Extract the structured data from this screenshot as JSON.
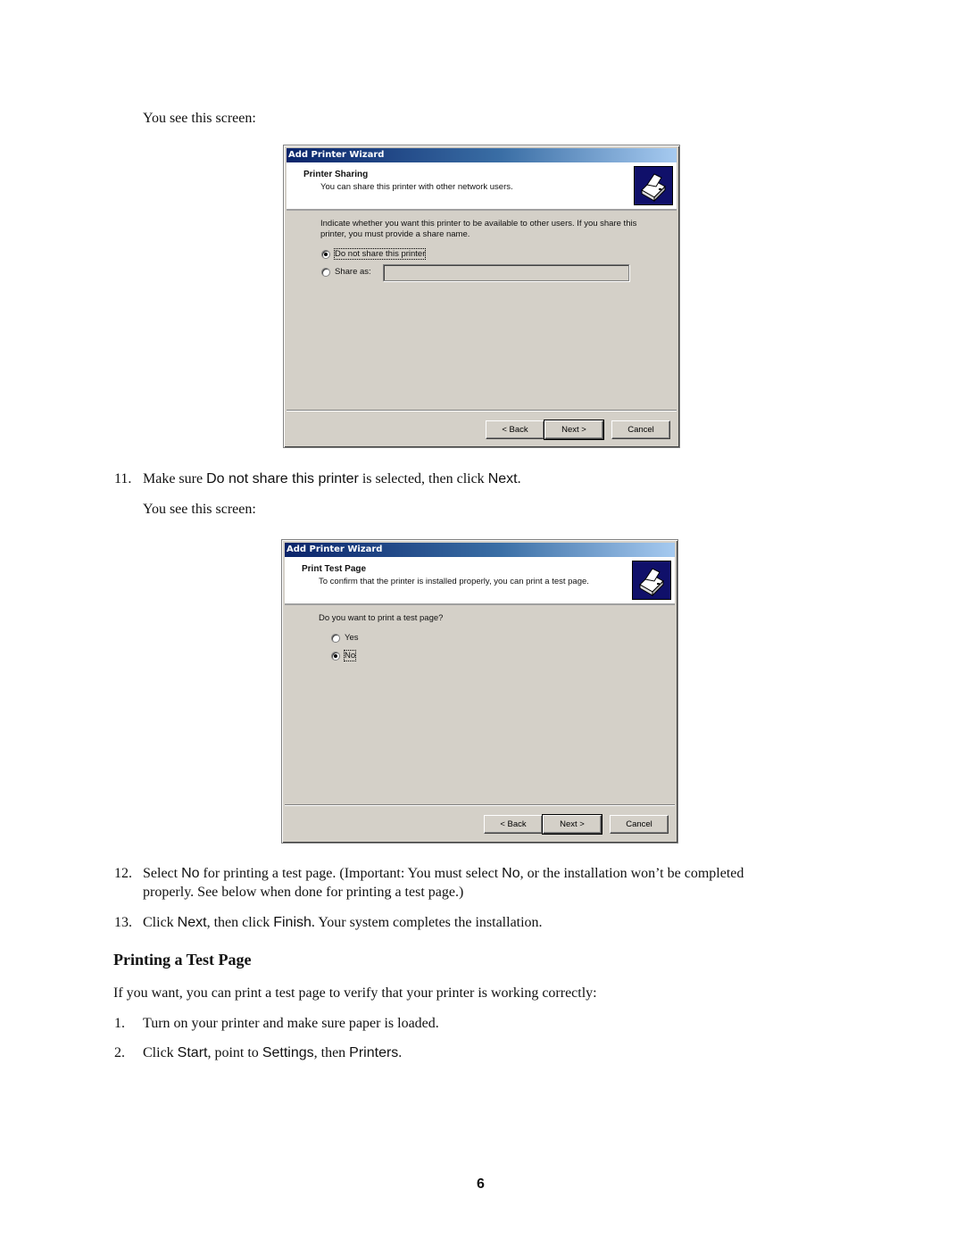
{
  "intro_1": "You see this screen:",
  "dialog_1": {
    "window_title": "Add Printer Wizard",
    "header_title": "Printer Sharing",
    "header_subtitle": "You can share this printer with other network users.",
    "icon": "printer-icon",
    "instructions_line1": "Indicate whether you want this printer to be available to other users. If you share this",
    "instructions_line2": "printer, you must provide a share name.",
    "options": [
      {
        "label": "Do not share this printer",
        "selected": true
      },
      {
        "label": "Share as:",
        "selected": false
      }
    ],
    "share_name_value": "",
    "buttons": {
      "back": "< Back",
      "next": "Next >",
      "cancel": "Cancel"
    }
  },
  "step_11": {
    "number": "11.",
    "pre": "Make sure ",
    "kw1": "Do not share this printer",
    "mid": " is selected, then click ",
    "kw2": "Next",
    "post": "."
  },
  "intro_2": "You see this screen:",
  "dialog_2": {
    "window_title": "Add Printer Wizard",
    "header_title": "Print Test Page",
    "header_subtitle": "To confirm that the printer is installed properly, you can print a test page.",
    "icon": "printer-icon",
    "question": "Do you want to print a test page?",
    "options": [
      {
        "label": "Yes",
        "selected": false
      },
      {
        "label": "No",
        "selected": true
      }
    ],
    "buttons": {
      "back": "< Back",
      "next": "Next >",
      "cancel": "Cancel"
    }
  },
  "step_12": {
    "number": "12.",
    "pre": "Select ",
    "kw1": "No",
    "mid": " for printing a test page. (Important: You must select ",
    "kw2": "No",
    "post": ", or the installation won’t be completed",
    "line2": "properly. See below when done for printing a test page.)"
  },
  "step_13": {
    "number": "13.",
    "pre": "Click ",
    "kw1": "Next",
    "mid": ", then click ",
    "kw2": "Finish",
    "post": ". Your system completes the installation."
  },
  "section": {
    "heading": "Printing a Test Page",
    "intro": "If you want, you can print a test page to verify that your printer is working correctly:",
    "steps": [
      {
        "number": "1.",
        "text": "Turn on your printer and make sure paper is loaded."
      },
      {
        "number": "2.",
        "pre": "Click ",
        "kw1": "Start",
        "mid": ", point to ",
        "kw2": "Settings",
        "mid2": ", then ",
        "kw3": "Printers",
        "post": "."
      }
    ]
  },
  "page_number": "6"
}
